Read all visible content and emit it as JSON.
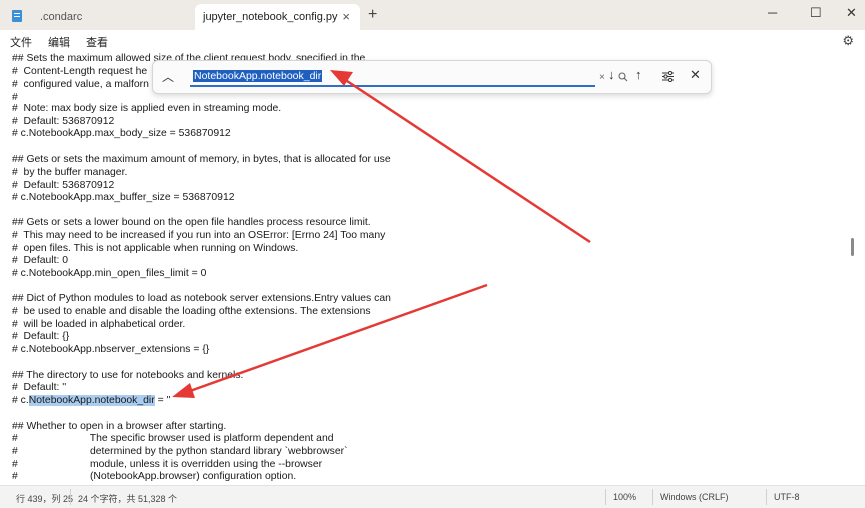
{
  "tabs": [
    {
      "label": ".condarc",
      "active": false
    },
    {
      "label": "jupyter_notebook_config.py",
      "active": true
    }
  ],
  "tab_close_glyph": "×",
  "new_tab_glyph": "+",
  "window_controls": {
    "minimize": "─",
    "maximize": "☐",
    "close": "✕"
  },
  "menu": {
    "file": "文件",
    "edit": "编辑",
    "view": "查看"
  },
  "find": {
    "query": "NotebookApp.notebook_dir",
    "clear_glyph": "×",
    "icons": [
      "search-icon",
      "arrow-down-icon",
      "arrow-up-icon",
      "options-icon",
      "close-icon"
    ]
  },
  "code_lines": [
    "## Sets the maximum allowed size of the client request body, specified in the",
    "#  Content-Length request he",
    "#  configured value, a malforn",
    "#",
    "#  Note: max body size is applied even in streaming mode.",
    "#  Default: 536870912",
    "# c.NotebookApp.max_body_size = 536870912",
    "",
    "## Gets or sets the maximum amount of memory, in bytes, that is allocated for use",
    "#  by the buffer manager.",
    "#  Default: 536870912",
    "# c.NotebookApp.max_buffer_size = 536870912",
    "",
    "## Gets or sets a lower bound on the open file handles process resource limit.",
    "#  This may need to be increased if you run into an OSError: [Errno 24] Too many",
    "#  open files. This is not applicable when running on Windows.",
    "#  Default: 0",
    "# c.NotebookApp.min_open_files_limit = 0",
    "",
    "## Dict of Python modules to load as notebook server extensions.Entry values can",
    "#  be used to enable and disable the loading ofthe extensions. The extensions",
    "#  will be loaded in alphabetical order.",
    "#  Default: {}",
    "# c.NotebookApp.nbserver_extensions = {}",
    "",
    "## The directory to use for notebooks and kernels.",
    "#  Default: ''",
    "",
    "",
    "## Whether to open in a browser after starting.",
    "#                         The specific browser used is platform dependent and",
    "#                         determined by the python standard library `webbrowser`",
    "#                         module, unless it is overridden using the --browser",
    "#                         (NotebookApp.browser) configuration option."
  ],
  "match_line": {
    "prefix": "# c.",
    "match": "NotebookApp.notebook_dir",
    "suffix": " = ''"
  },
  "status": {
    "position": "行 439，列 25",
    "chars": "24 个字符，共 51,328 个",
    "zoom": "100%",
    "eol": "Windows (CRLF)",
    "encoding": "UTF-8"
  },
  "annotation_color": "#e53935"
}
